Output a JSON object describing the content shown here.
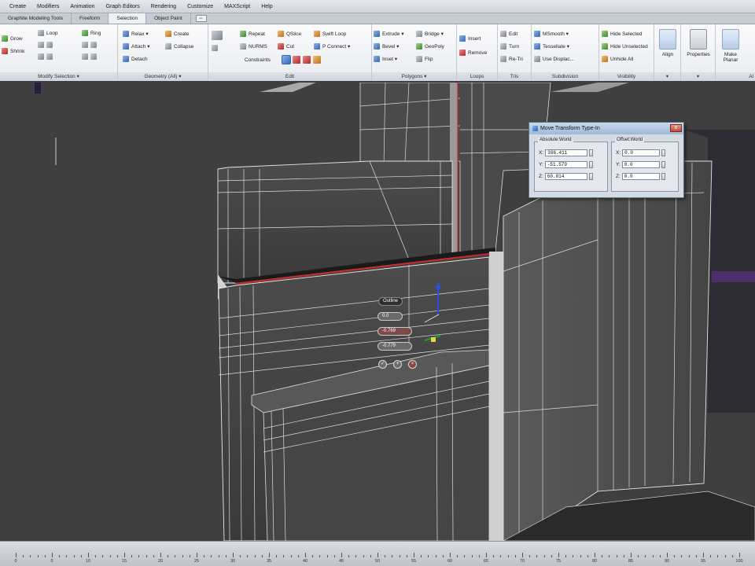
{
  "menubar": {
    "items": [
      "Create",
      "Modifiers",
      "Animation",
      "Graph Editors",
      "Rendering",
      "Customize",
      "MAXScript",
      "Help"
    ]
  },
  "tabs": {
    "items": [
      "Graphite Modeling Tools",
      "Freeform",
      "Selection",
      "Object Paint"
    ],
    "active_index": 2,
    "toggle_label": "▫▫"
  },
  "ribbon": {
    "panels": {
      "modify_selection": "Modify Selection ▾",
      "geometry": "Geometry (All) ▾",
      "edit": "Edit",
      "polygons": "Polygons ▾",
      "loops": "Loops",
      "tris": "Tris",
      "subdivision": "Subdivision",
      "visibility": "Visibility",
      "align": "",
      "properties": ""
    },
    "modify_selection": {
      "grow": "Grow",
      "shrink": "Shrink",
      "loop": "Loop",
      "ring": "Ring"
    },
    "geometry": {
      "relax": "Relax ▾",
      "attach": "Attach ▾",
      "detach": "Detach",
      "create": "Create",
      "collapse": "Collapse"
    },
    "edit": {
      "repeat": "Repeat",
      "nurms": "NURMS",
      "qslice": "QSlice",
      "cut": "Cut",
      "swiftloop": "Swift Loop",
      "pconnect": "P Connect ▾",
      "constraints": "Constraints"
    },
    "polygons": {
      "extrude": "Extrude ▾",
      "bevel": "Bevel ▾",
      "inset": "Inset ▾",
      "bridge": "Bridge ▾",
      "geopoly": "GeoPoly",
      "flip": "Flip"
    },
    "loops": {
      "insert": "Insert",
      "remove": "Remove"
    },
    "tris": {
      "edit": "Edit",
      "turn": "Turn",
      "retri": "Re-Tri"
    },
    "subdivision": {
      "msmooth": "MSmooth ▾",
      "tessellate": "Tessellate ▾",
      "usedisplace": "Use Displac..."
    },
    "visibility": {
      "hide_selected": "Hide Selected",
      "hide_unselected": "Hide Unselected",
      "unhide_all": "Unhide All"
    },
    "big": {
      "align": "Align",
      "properties": "Properties",
      "make_planar": "Make Planar",
      "al": "Al"
    }
  },
  "dialog": {
    "title": "Move Transform Type-In",
    "close": "x",
    "absolute": {
      "label": "Absolute:World",
      "x_label": "X:",
      "x": "386.411",
      "y_label": "Y:",
      "y": "-51.579",
      "z_label": "Z:",
      "z": "60.014"
    },
    "offset": {
      "label": "Offset:World",
      "x_label": "X:",
      "x": "0.0",
      "y_label": "Y:",
      "y": "0.0",
      "z_label": "Z:",
      "z": "0.0"
    }
  },
  "caddy": {
    "mode": "Outline",
    "value1": "0.0",
    "value2": "-0.769",
    "value3": "-0.779",
    "ok": "✓",
    "apply": "+",
    "cancel": "×"
  },
  "timeline": {
    "ticks": [
      "0",
      "5",
      "10",
      "15",
      "20",
      "25",
      "30",
      "35",
      "40",
      "45",
      "50",
      "55",
      "60",
      "65",
      "70",
      "75",
      "80",
      "85",
      "90",
      "95",
      "100"
    ]
  },
  "colors": {
    "selected_edge": "#c8282a",
    "wire": "#e8e8e8",
    "mesh": "#474747",
    "viewport_bg": "#3c3c3c",
    "accent": "#e8d44c"
  }
}
